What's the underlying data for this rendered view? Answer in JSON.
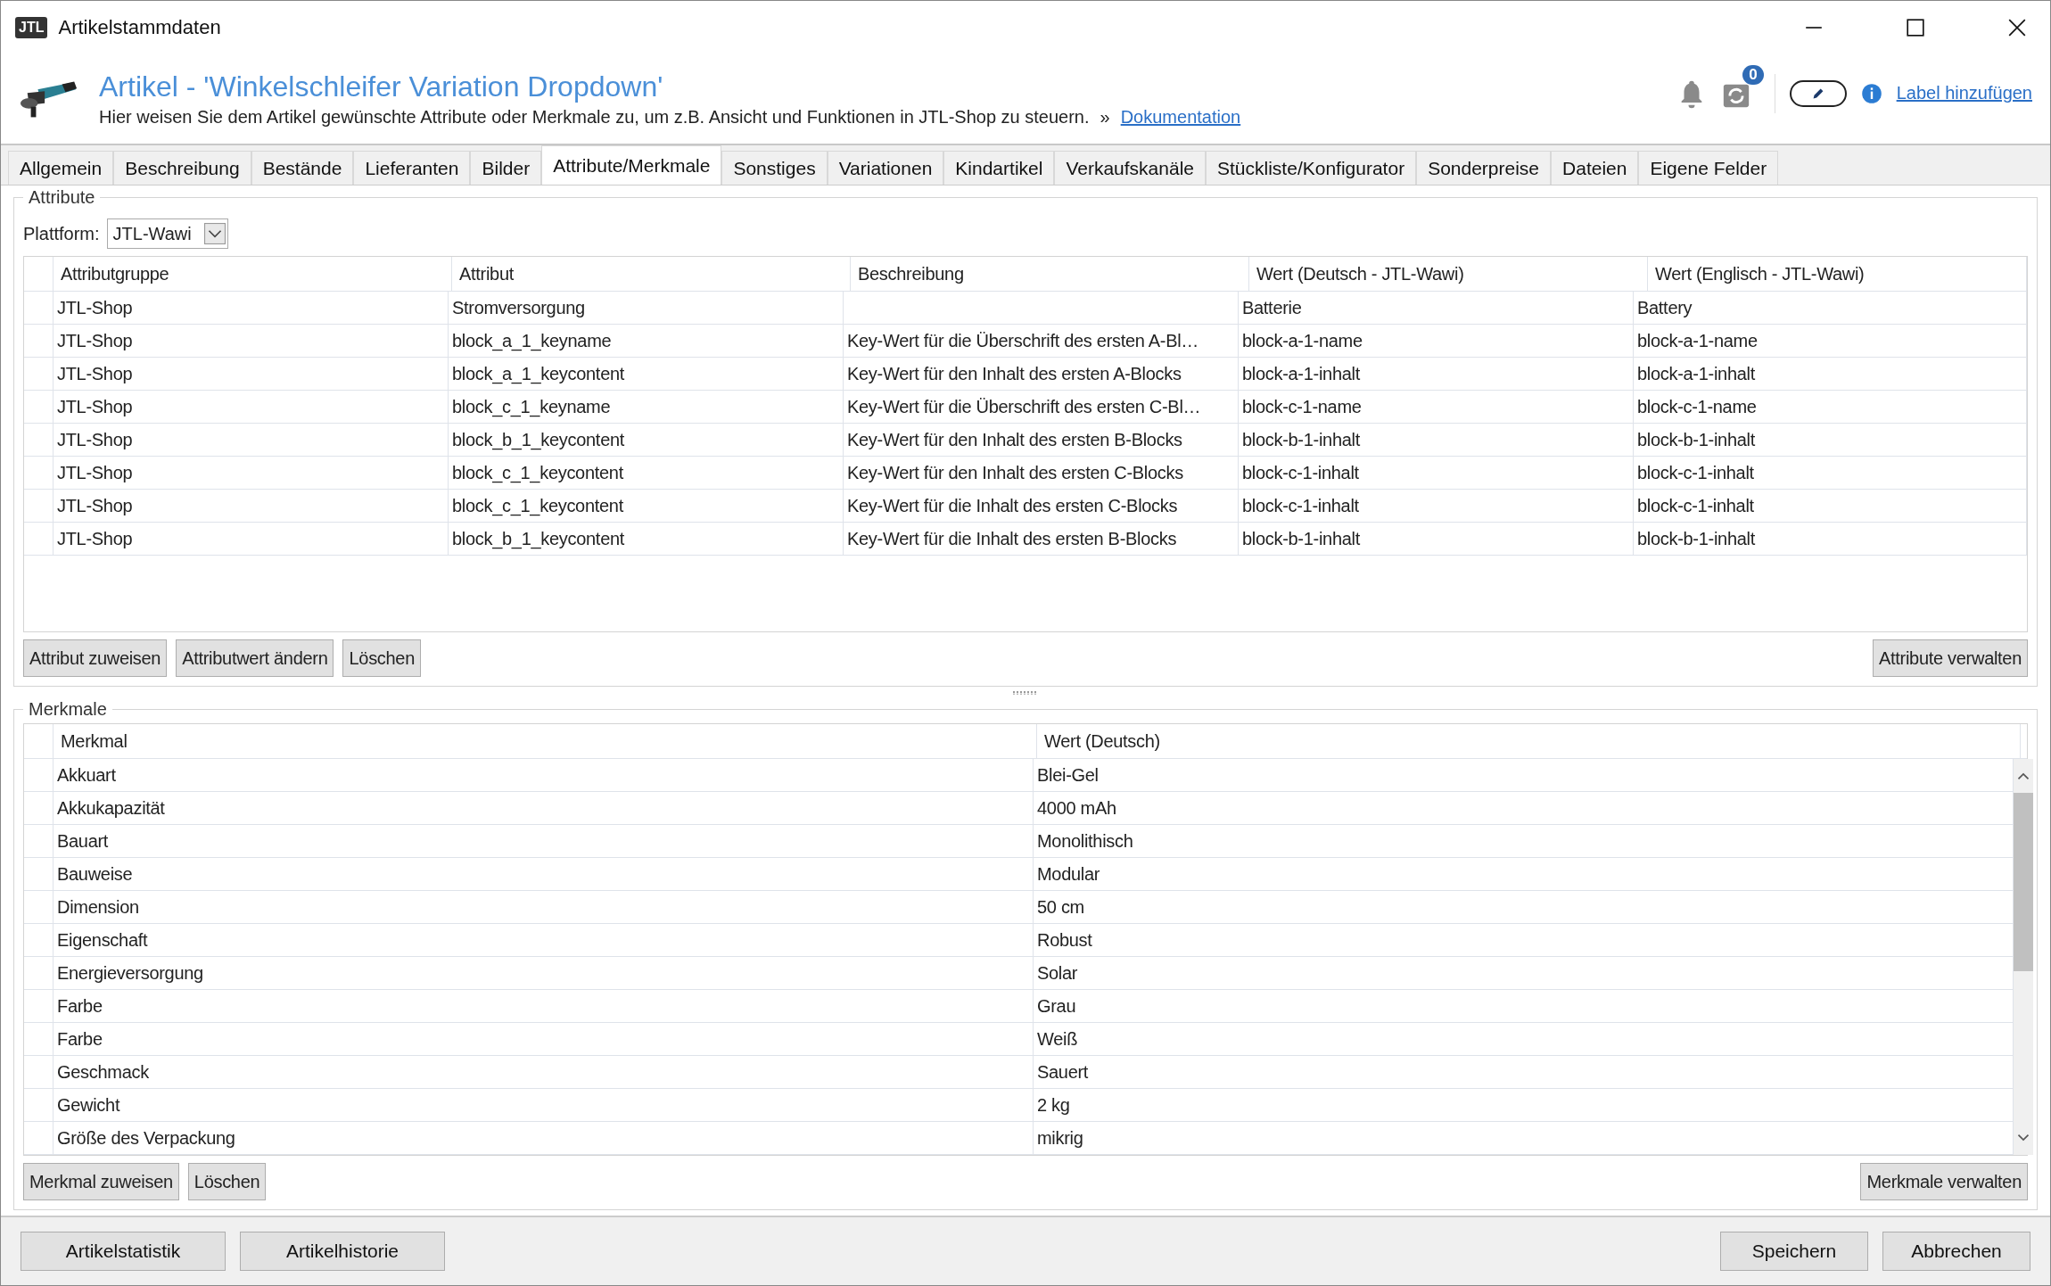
{
  "window": {
    "logo": "JTL",
    "title": "Artikelstammdaten"
  },
  "header": {
    "title": "Artikel - 'Winkelschleifer Variation Dropdown'",
    "subtitle": "Hier weisen Sie dem Artikel gewünschte Attribute oder Merkmale zu, um z.B. Ansicht und Funktionen in JTL-Shop zu steuern.",
    "separator": "»",
    "link": "Dokumentation",
    "sync_count": "0",
    "label_link": "Label hinzufügen"
  },
  "tabs": [
    {
      "label": "Allgemein",
      "selected": false
    },
    {
      "label": "Beschreibung",
      "selected": false
    },
    {
      "label": "Bestände",
      "selected": false
    },
    {
      "label": "Lieferanten",
      "selected": false
    },
    {
      "label": "Bilder",
      "selected": false
    },
    {
      "label": "Attribute/Merkmale",
      "selected": true
    },
    {
      "label": "Sonstiges",
      "selected": false
    },
    {
      "label": "Variationen",
      "selected": false
    },
    {
      "label": "Kindartikel",
      "selected": false
    },
    {
      "label": "Verkaufskanäle",
      "selected": false
    },
    {
      "label": "Stückliste/Konfigurator",
      "selected": false
    },
    {
      "label": "Sonderpreise",
      "selected": false
    },
    {
      "label": "Dateien",
      "selected": false
    },
    {
      "label": "Eigene Felder",
      "selected": false
    }
  ],
  "attributes": {
    "legend": "Attribute",
    "platform_label": "Plattform:",
    "platform_value": "JTL-Wawi",
    "columns": [
      "Attributgruppe",
      "Attribut",
      "Beschreibung",
      "Wert (Deutsch - JTL-Wawi)",
      "Wert (Englisch - JTL-Wawi)"
    ],
    "rows": [
      [
        "JTL-Shop",
        "Stromversorgung",
        "",
        "Batterie",
        "Battery"
      ],
      [
        "JTL-Shop",
        "block_a_1_keyname",
        "Key-Wert für die Überschrift des ersten A-Bl…",
        "block-a-1-name",
        "block-a-1-name"
      ],
      [
        "JTL-Shop",
        "block_a_1_keycontent",
        "Key-Wert für den Inhalt des ersten A-Blocks",
        "block-a-1-inhalt",
        "block-a-1-inhalt"
      ],
      [
        "JTL-Shop",
        "block_c_1_keyname",
        "Key-Wert für die Überschrift des ersten C-Bl…",
        "block-c-1-name",
        "block-c-1-name"
      ],
      [
        "JTL-Shop",
        "block_b_1_keycontent",
        "Key-Wert für den Inhalt des ersten B-Blocks",
        "block-b-1-inhalt",
        "block-b-1-inhalt"
      ],
      [
        "JTL-Shop",
        "block_c_1_keycontent",
        "Key-Wert für den Inhalt des ersten C-Blocks",
        "block-c-1-inhalt",
        "block-c-1-inhalt"
      ],
      [
        "JTL-Shop",
        "block_c_1_keycontent",
        "Key-Wert für die Inhalt des ersten C-Blocks",
        "block-c-1-inhalt",
        "block-c-1-inhalt"
      ],
      [
        "JTL-Shop",
        "block_b_1_keycontent",
        "Key-Wert für die Inhalt des ersten B-Blocks",
        "block-b-1-inhalt",
        "block-b-1-inhalt"
      ]
    ],
    "buttons": [
      "Attribut zuweisen",
      "Attributwert ändern",
      "Löschen"
    ],
    "manage_button": "Attribute verwalten"
  },
  "features": {
    "legend": "Merkmale",
    "columns": [
      "Merkmal",
      "Wert (Deutsch)"
    ],
    "rows": [
      [
        "Akkuart",
        "Blei-Gel"
      ],
      [
        "Akkukapazität",
        "4000 mAh"
      ],
      [
        "Bauart",
        "Monolithisch"
      ],
      [
        "Bauweise",
        "Modular"
      ],
      [
        "Dimension",
        "50 cm"
      ],
      [
        "Eigenschaft",
        "Robust"
      ],
      [
        "Energieversorgung",
        "Solar"
      ],
      [
        "Farbe",
        "Grau"
      ],
      [
        "Farbe",
        "Weiß"
      ],
      [
        "Geschmack",
        "Sauert"
      ],
      [
        "Gewicht",
        "2 kg"
      ],
      [
        "Größe des Verpackung",
        "mikrig"
      ]
    ],
    "buttons": [
      "Merkmal zuweisen",
      "Löschen"
    ],
    "manage_button": "Merkmale verwalten"
  },
  "footer": {
    "left": [
      "Artikelstatistik",
      "Artikelhistorie"
    ],
    "right": [
      "Speichern",
      "Abbrechen"
    ]
  }
}
